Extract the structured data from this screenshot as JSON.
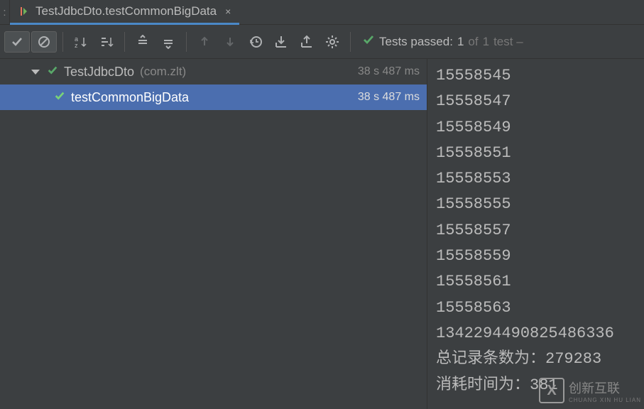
{
  "tab": {
    "title": "TestJdbcDto.testCommonBigData",
    "close": "×"
  },
  "sideLabel": ":",
  "toolbar": {
    "iconNames": [
      "check",
      "block",
      "sort-alpha",
      "sort-tree",
      "collapse-up",
      "collapse-down",
      "arrow-up",
      "arrow-down",
      "history",
      "import",
      "export",
      "gear"
    ]
  },
  "status": {
    "prefix": "Tests passed:",
    "passed": "1",
    "mid": "of",
    "total": "1",
    "suffix": "test –"
  },
  "tree": {
    "root": {
      "name": "TestJdbcDto",
      "pkg": "(com.zlt)",
      "time": "38 s 487 ms"
    },
    "child": {
      "name": "testCommonBigData",
      "time": "38 s 487 ms"
    }
  },
  "console": {
    "lines": [
      "15558545",
      "15558547",
      "15558549",
      "15558551",
      "15558553",
      "15558555",
      "15558557",
      "15558559",
      "15558561",
      "15558563",
      "1342294490825486336",
      "总记录条数为：279283",
      "消耗时间为：381"
    ]
  },
  "watermark": {
    "text": "创新互联",
    "sub": "CHUANG XIN HU LIAN",
    "logo": "X"
  }
}
